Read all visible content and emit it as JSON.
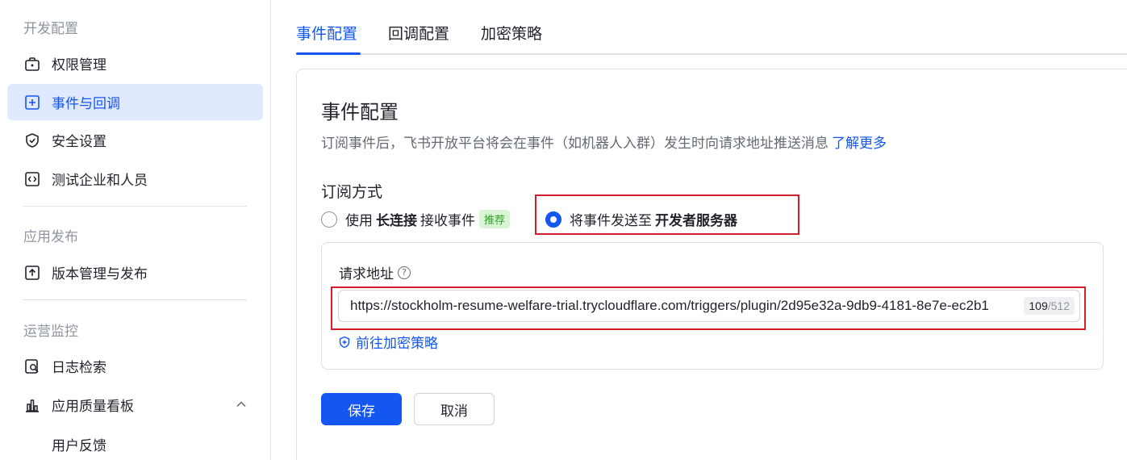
{
  "sidebar": {
    "sections": [
      {
        "title": "开发配置"
      },
      {
        "title": "应用发布"
      },
      {
        "title": "运营监控"
      }
    ],
    "items": [
      {
        "label": "权限管理",
        "icon": "permission-icon"
      },
      {
        "label": "事件与回调",
        "icon": "event-icon"
      },
      {
        "label": "安全设置",
        "icon": "shield-icon"
      },
      {
        "label": "测试企业和人员",
        "icon": "code-icon"
      },
      {
        "label": "版本管理与发布",
        "icon": "upload-icon"
      },
      {
        "label": "日志检索",
        "icon": "log-search-icon"
      },
      {
        "label": "应用质量看板",
        "icon": "bar-chart-icon"
      }
    ],
    "sub_items": [
      {
        "label": "用户反馈"
      }
    ]
  },
  "tabs": [
    {
      "label": "事件配置"
    },
    {
      "label": "回调配置"
    },
    {
      "label": "加密策略"
    }
  ],
  "card": {
    "title": "事件配置",
    "description": "订阅事件后，飞书开放平台将会在事件（如机器人入群）发生时向请求地址推送消息",
    "learn_more": "了解更多",
    "subscription_label": "订阅方式",
    "option_long_connection": {
      "prefix": "使用",
      "bold": "长连接",
      "suffix": "接收事件",
      "badge": "推荐"
    },
    "option_server": {
      "prefix": "将事件发送至",
      "bold": "开发者服务器"
    },
    "request_url_label": "请求地址",
    "request_url_value": "https://stockholm-resume-welfare-trial.trycloudflare.com/triggers/plugin/2d95e32a-9db9-4181-8e7e-ec2b1",
    "char_count": "109",
    "char_total": "/512",
    "encrypt_link": "前往加密策略",
    "save_label": "保存",
    "cancel_label": "取消"
  },
  "colors": {
    "accent": "#1456f0",
    "highlight_border": "#d1202c"
  }
}
